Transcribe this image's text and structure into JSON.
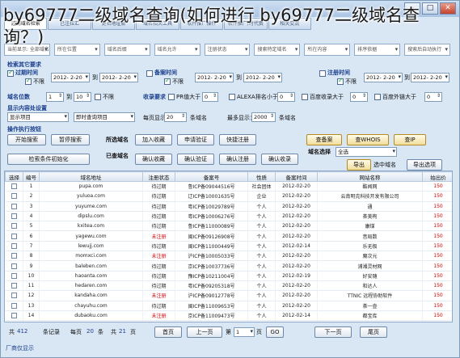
{
  "overlay_title": "by69777二级域名查询(如何进行 by69777二级域名查询？)",
  "window": {
    "minimize": "–",
    "maximize": "□",
    "close": "✕"
  },
  "tabs": [
    "过期域名检索",
    "已注拉汇",
    "更名地址解",
    "域名相关工具",
    "软件推广操作",
    "软件推广/时代费",
    "相关交流"
  ],
  "filter_bar": [
    "当前显示: 全部域名",
    "所在位置",
    "域名后缀",
    "域名允许",
    "注册状态",
    "搜索特定域名",
    "所在内容",
    "排序依据",
    "搜索后自动执行"
  ],
  "panel": {
    "section_search": "检索其它要求",
    "expired_time": "过期时间",
    "date_from_1": "2012- 2-20",
    "to_1": "到",
    "date_to_1": "2012- 2-20",
    "unlimited": "不限",
    "record_time": "备案时间",
    "date_from_2": "2012- 2-20",
    "to_2": "到",
    "date_to_2": "2012- 2-20",
    "register_time": "注册时间",
    "date_from_3": "2012- 2-20",
    "to_3": "到",
    "date_to_3": "2012- 2-20",
    "domain_digits": "域名位数",
    "digits_min": "1",
    "digits_to": "到",
    "digits_max": "10",
    "no_limit": "不限",
    "collect_count": "收录要求",
    "pr_label": "PR值大于",
    "pr_value": "0",
    "alexa_label": "ALEXA排名小于",
    "alexa_value": "0",
    "baidu_label": "百度收录大于",
    "baidu_value": "0",
    "outlink_label": "百度外链大于",
    "outlink_value": "0",
    "display_section": "显示内容处设置",
    "display_select": "显示项目",
    "query_select": "即时查询项目",
    "per_page_label": "每页显示：",
    "per_page_value": "20",
    "per_page_unit": "条域名",
    "total_label": "最多显示：",
    "total_value": "2000",
    "total_unit": "条域名",
    "action_section": "操作执行按钮",
    "start_btn": "开始搜索",
    "pause_btn": "暂停搜索",
    "selected_label": "所选域名",
    "add_fav_btn": "加入收藏",
    "apply_btn": "申请验证",
    "quick_reg_btn": "快捷注册",
    "check_record_btn": "查备案",
    "check_whois_btn": "查WHOIS",
    "check_ip_btn": "查IP",
    "reset_btn": "检索条件初始化",
    "checked_label": "已查域名",
    "confirm_fav_btn": "确认收藏",
    "confirm_verify_btn": "确认验证",
    "confirm_reg_btn": "确认注册",
    "confirm_collect_btn": "确认收录",
    "domain_select_label": "域名选择",
    "domain_select_value": "全选",
    "export_btn": "导出",
    "export_label": "选中域名",
    "export_option_btn": "导出选项"
  },
  "table": {
    "columns": [
      "选择",
      "编号",
      "域名地址",
      "注册状态",
      "备案号",
      "性质",
      "备案时间",
      "网站名称",
      "拍出价"
    ],
    "rows": [
      [
        "1",
        "pupa.com",
        "待过期",
        "鲁ICP备09044516号",
        "社会团体",
        "2012-02-20",
        "酷闻网",
        "150"
      ],
      [
        "2",
        "yuluoa.com",
        "待过期",
        "辽ICP备10001635号",
        "企业",
        "2012-02-20",
        "云南明克科技开发有限公司",
        "150"
      ],
      [
        "3",
        "yuyume.com",
        "待过期",
        "粤ICP备10029789号",
        "个人",
        "2012-02-20",
        "通",
        "150"
      ],
      [
        "4",
        "dipslu.com",
        "待过期",
        "粤ICP备10006276号",
        "个人",
        "2012-02-20",
        "茶美枸",
        "150"
      ],
      [
        "5",
        "kxitea.com",
        "待过期",
        "鲁ICP备11000089号",
        "个人",
        "2012-02-20",
        "康煤",
        "150"
      ],
      [
        "6",
        "yagewu.com",
        "未注册",
        "闽ICP备09126908号",
        "个人",
        "2012-02-20",
        "音局数",
        "150"
      ],
      [
        "7",
        "lewujj.com",
        "待过期",
        "闽ICP备11000449号",
        "个人",
        "2012-02-14",
        "乐无极",
        "150"
      ],
      [
        "8",
        "momxci.com",
        "未注册",
        "沪ICP备10005033号",
        "个人",
        "2012-02-20",
        "魔次元",
        "150"
      ],
      [
        "9",
        "baleben.com",
        "待过期",
        "京ICP备10037736号",
        "个人",
        "2012-02-20",
        "浦湘灵材网",
        "150"
      ],
      [
        "10",
        "haoanta.com",
        "待过期",
        "豫ICP备10211004号",
        "个人",
        "2012-02-19",
        "好安随",
        "150"
      ],
      [
        "11",
        "hedaren.com",
        "待过期",
        "粤ICP备09205318号",
        "个人",
        "2012-02-20",
        "和达人",
        "150"
      ],
      [
        "12",
        "kandaha.com",
        "未注册",
        "沪ICP备09012778号",
        "个人",
        "2012-02-20",
        "TTNIC 远程协助软件",
        "150"
      ],
      [
        "13",
        "chayuhu.com",
        "待过期",
        "闽ICP备11009653号",
        "个人",
        "2012-02-20",
        "茶一壶",
        "150"
      ],
      [
        "14",
        "dubaoku.com",
        "未注册",
        "京ICP备11009473号",
        "个人",
        "2012-02-14",
        "都宝库",
        "150"
      ],
      [
        "15",
        "vivialin.com",
        "待过期",
        "浙ICP备10038431号",
        "个人",
        "2012-02-20",
        "佳木之行",
        "150"
      ]
    ]
  },
  "footer": {
    "total_prefix": "共",
    "total_value": "412",
    "total_suffix": "条记录",
    "per_page_prefix": "每页",
    "per_page_value": "20",
    "per_page_suffix": "条",
    "pages_prefix": "共",
    "pages_value": "21",
    "pages_suffix": "页",
    "first_btn": "首页",
    "prev_btn": "上一页",
    "page_prefix": "第",
    "page_value": "1",
    "page_suffix": "页",
    "goto_btn": "GO",
    "next_btn": "下一页",
    "last_btn": "尾页"
  },
  "status_bar": "厂商仅显示"
}
